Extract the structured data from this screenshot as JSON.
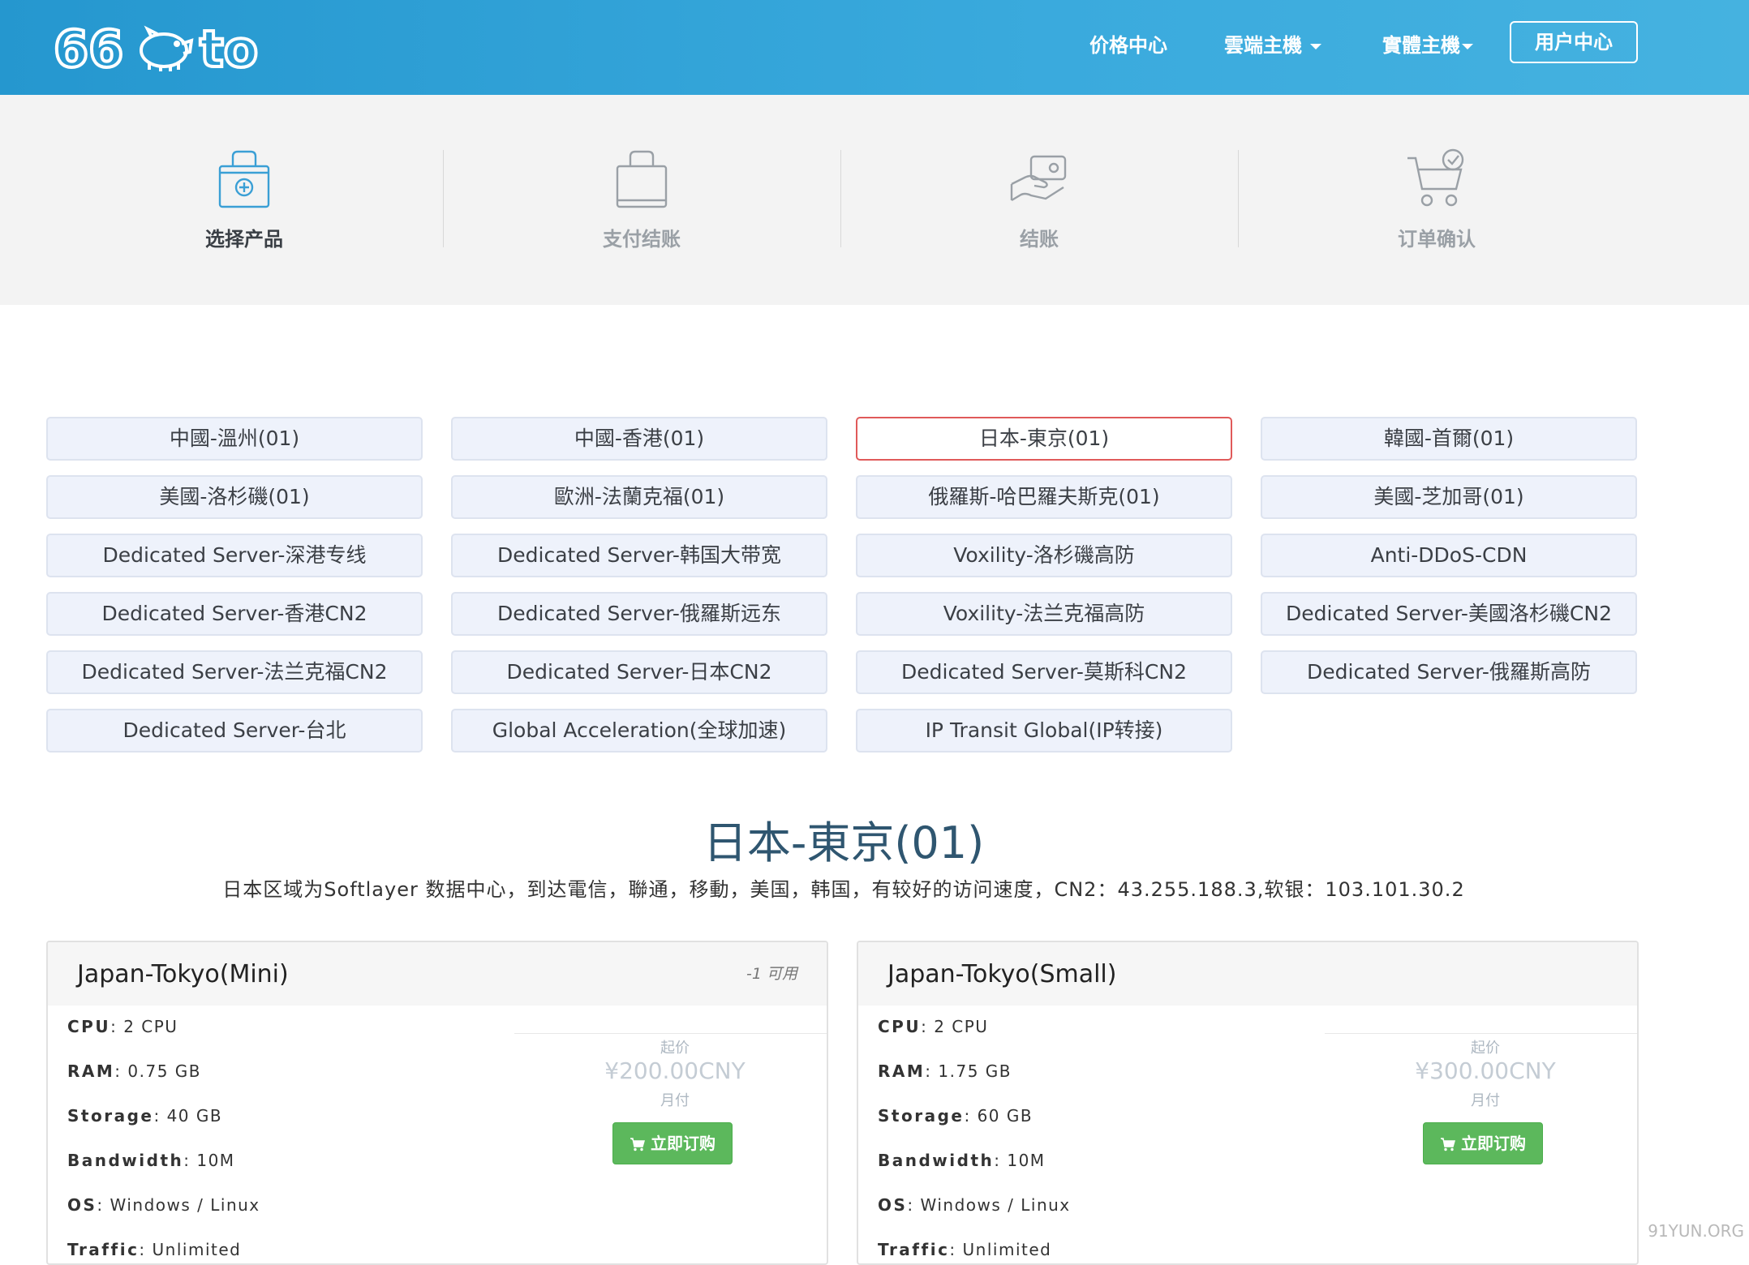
{
  "header": {
    "logo_text": "66to",
    "nav": [
      {
        "label": "价格中心",
        "has_caret": false
      },
      {
        "label": "雲端主機",
        "has_caret": true
      },
      {
        "label": "實體主機",
        "has_caret": true
      }
    ],
    "user_center": "用户中心",
    "bg_color": "#2b9fd4"
  },
  "steps": [
    {
      "label": "选择产品",
      "icon": "bag-plus-icon",
      "active": true
    },
    {
      "label": "支付结账",
      "icon": "bag-icon",
      "active": false
    },
    {
      "label": "结账",
      "icon": "card-hand-icon",
      "active": false
    },
    {
      "label": "订单确认",
      "icon": "cart-check-icon",
      "active": false
    }
  ],
  "regions": [
    {
      "label": "中國-溫州(01)",
      "active": false
    },
    {
      "label": "中國-香港(01)",
      "active": false
    },
    {
      "label": "日本-東京(01)",
      "active": true
    },
    {
      "label": "韓國-首爾(01)",
      "active": false
    },
    {
      "label": "美國-洛杉磯(01)",
      "active": false
    },
    {
      "label": "歐洲-法蘭克福(01)",
      "active": false
    },
    {
      "label": "俄羅斯-哈巴羅夫斯克(01)",
      "active": false
    },
    {
      "label": "美國-芝加哥(01)",
      "active": false
    },
    {
      "label": "Dedicated Server-深港专线",
      "active": false
    },
    {
      "label": "Dedicated Server-韩国大带宽",
      "active": false
    },
    {
      "label": "Voxility-洛杉磯高防",
      "active": false
    },
    {
      "label": "Anti-DDoS-CDN",
      "active": false
    },
    {
      "label": "Dedicated Server-香港CN2",
      "active": false
    },
    {
      "label": "Dedicated Server-俄羅斯远东",
      "active": false
    },
    {
      "label": "Voxility-法兰克福高防",
      "active": false
    },
    {
      "label": "Dedicated Server-美國洛杉磯CN2",
      "active": false
    },
    {
      "label": "Dedicated Server-法兰克福CN2",
      "active": false
    },
    {
      "label": "Dedicated Server-日本CN2",
      "active": false
    },
    {
      "label": "Dedicated Server-莫斯科CN2",
      "active": false
    },
    {
      "label": "Dedicated Server-俄羅斯高防",
      "active": false
    },
    {
      "label": "Dedicated Server-台北",
      "active": false
    },
    {
      "label": "Global Acceleration(全球加速)",
      "active": false
    },
    {
      "label": "IP Transit Global(IP转接)",
      "active": false
    }
  ],
  "region_title": "日本-東京(01)",
  "region_desc": "日本区域为Softlayer 数据中心，到达電信，聯通，移動，美国，韩国，有较好的访问速度，CN2：43.255.188.3,软银：103.101.30.2",
  "products": [
    {
      "name": "Japan-Tokyo(Mini)",
      "availability": "-1 可用",
      "specs": [
        {
          "key": "CPU",
          "value": "2 CPU"
        },
        {
          "key": "RAM",
          "value": "0.75 GB"
        },
        {
          "key": "Storage",
          "value": "40 GB"
        },
        {
          "key": "Bandwidth",
          "value": "10M"
        },
        {
          "key": "OS",
          "value": "Windows / Linux"
        },
        {
          "key": "Traffic",
          "value": "Unlimited"
        }
      ],
      "price_from": "起价",
      "price": "¥200.00CNY",
      "cycle": "月付",
      "order_label": "立即订购"
    },
    {
      "name": "Japan-Tokyo(Small)",
      "availability": "",
      "specs": [
        {
          "key": "CPU",
          "value": "2 CPU"
        },
        {
          "key": "RAM",
          "value": "1.75 GB"
        },
        {
          "key": "Storage",
          "value": "60 GB"
        },
        {
          "key": "Bandwidth",
          "value": "10M"
        },
        {
          "key": "OS",
          "value": "Windows / Linux"
        },
        {
          "key": "Traffic",
          "value": "Unlimited"
        }
      ],
      "price_from": "起价",
      "price": "¥300.00CNY",
      "cycle": "月付",
      "order_label": "立即订购"
    }
  ],
  "watermark": "91YUN.ORG"
}
